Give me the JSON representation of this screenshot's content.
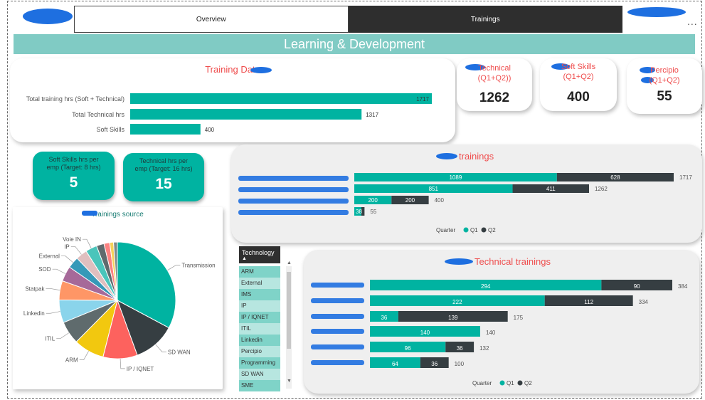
{
  "tabs": [
    {
      "label": "Overview",
      "active": false
    },
    {
      "label": "Trainings",
      "active": true
    }
  ],
  "more_label": "...",
  "banner_title": "Learning & Development",
  "kpis": [
    {
      "title_line1": "Technical",
      "title_line2": "(Q1+Q2))",
      "value": "1262"
    },
    {
      "title_line1": "Soft Skills",
      "title_line2": "(Q1+Q2)",
      "value": "400"
    },
    {
      "title_line1": "Percipio",
      "title_line2": "(Q1+Q2)",
      "value": "55"
    }
  ],
  "per_emp": [
    {
      "label_line1": "Soft Skills hrs per",
      "label_line2": "emp (Target: 8 hrs)",
      "value": "5"
    },
    {
      "label_line1": "Technical hrs per",
      "label_line2": "emp (Target: 16 hrs)",
      "value": "15"
    }
  ],
  "slicer": {
    "header": "Technology",
    "sort_icon": "sort-up-icon",
    "items": [
      "ARM",
      "External",
      "IMS",
      "IP",
      "IP / IQNET",
      "ITIL",
      "Linkedin",
      "Percipio",
      "Programming",
      "SD WAN",
      "SME"
    ]
  },
  "colors": {
    "q1": "#00b3a1",
    "q2": "#363e42",
    "accent": "#ef4d4d",
    "banner": "#80cbc4"
  },
  "chart_data": [
    {
      "type": "bar",
      "title": "Training Data",
      "categories": [
        "Total training hrs (Soft + Technical)",
        "Total Technical hrs",
        "Soft Skills"
      ],
      "values": [
        1717,
        1317,
        400
      ],
      "xlim": [
        0,
        1717
      ]
    },
    {
      "type": "bar",
      "stacked": true,
      "title": "trainings",
      "categories": [
        "",
        "",
        "",
        ""
      ],
      "series": [
        {
          "name": "Q1",
          "values": [
            1089,
            851,
            200,
            38
          ]
        },
        {
          "name": "Q2",
          "values": [
            628,
            411,
            200,
            17
          ]
        }
      ],
      "totals": [
        1717,
        1262,
        400,
        55
      ],
      "legend_title": "Quarter",
      "legend_position": "bottom"
    },
    {
      "type": "bar",
      "stacked": true,
      "title": "Technical trainings",
      "categories": [
        "",
        "",
        "",
        "",
        "",
        ""
      ],
      "series": [
        {
          "name": "Q1",
          "values": [
            294,
            222,
            36,
            140,
            96,
            64
          ]
        },
        {
          "name": "Q2",
          "values": [
            90,
            112,
            139,
            0,
            36,
            36
          ]
        }
      ],
      "totals": [
        384,
        334,
        175,
        140,
        132,
        100
      ],
      "legend_title": "Quarter",
      "legend_position": "bottom"
    },
    {
      "type": "pie",
      "title": "Trainings source",
      "labels": [
        "Transmission",
        "SD WAN",
        "IP / IQNET",
        "ARM",
        "ITIL",
        "Linkedin",
        "Statpak",
        "SOD",
        "External",
        "IP",
        "Voie IN",
        "",
        "",
        "",
        ""
      ],
      "values": [
        31,
        11,
        9,
        8,
        6,
        6,
        5,
        4,
        3,
        3,
        3,
        2,
        1.5,
        1,
        1
      ],
      "colors": [
        "#00b3a1",
        "#363e42",
        "#fd625e",
        "#f2c80f",
        "#5f6b6d",
        "#8ad4eb",
        "#fe9666",
        "#a66999",
        "#3599b8",
        "#dfbfbf",
        "#4ac5bb",
        "#5f6b6d",
        "#fb8281",
        "#f4d25a",
        "#7f898a"
      ]
    }
  ]
}
